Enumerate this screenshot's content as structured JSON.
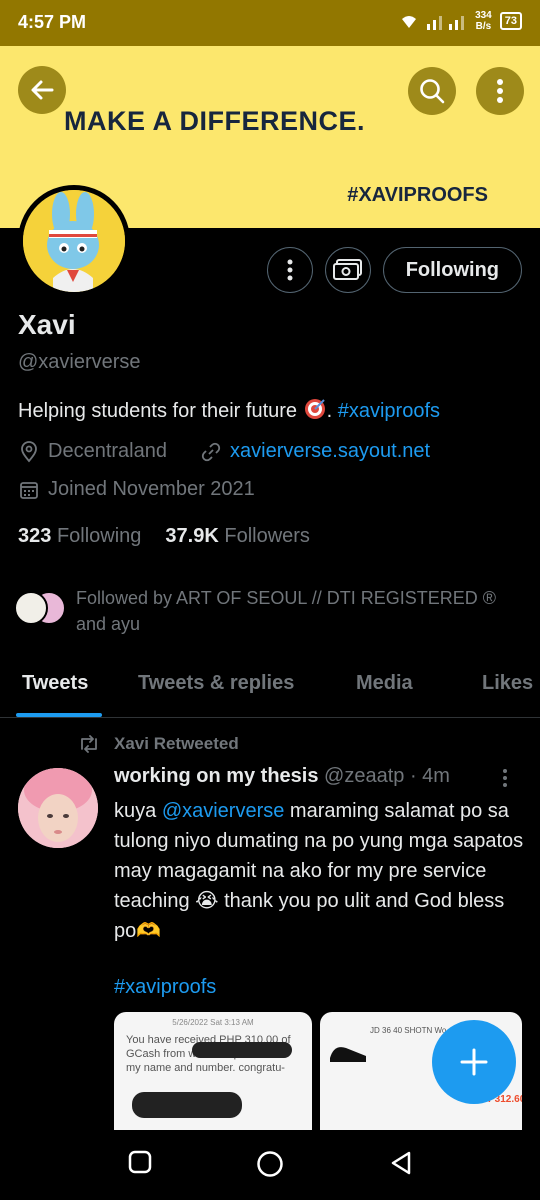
{
  "status_bar": {
    "time": "4:57 PM",
    "speed_value": "334",
    "speed_unit": "B/s",
    "battery": "73"
  },
  "banner": {
    "headline": "MAKE A DIFFERENCE.",
    "hashtag": "#XAVIPROOFS",
    "color": "#fce76d"
  },
  "profile": {
    "following_button": "Following",
    "name": "Xavi",
    "handle": "@xavierverse",
    "bio_text": "Helping students for their future ",
    "bio_suffix": ". ",
    "bio_hashtag": "#xaviproofs",
    "location": "Decentraland",
    "website": "xavierverse.sayout.net",
    "joined": "Joined November 2021",
    "following_count": "323",
    "following_label": "Following",
    "followers_count": "37.9K",
    "followers_label": "Followers",
    "followed_by": "Followed by ART OF SEOUL // DTI REGISTERED ® and ayu"
  },
  "tabs": [
    {
      "label": "Tweets",
      "active": true
    },
    {
      "label": "Tweets & replies",
      "active": false
    },
    {
      "label": "Media",
      "active": false
    },
    {
      "label": "Likes",
      "active": false
    }
  ],
  "tweet": {
    "retweeted_by": "Xavi Retweeted",
    "author_name": "working on my thesis",
    "author_handle": "@zeaatp",
    "time": "· 4m",
    "body_start": "kuya ",
    "mention": "@xavierverse",
    "body_rest": " maraming salamat po sa tulong niyo dumating na po yung mga sapatos may magagamit na ako for my pre service teaching 😭 thank you po ulit and God bless po🫶",
    "hashtag": "#xaviproofs",
    "media_1_text": "You have received PHP 310.00 of GCash from  w/ MSG: please hide my name and number. congratu-",
    "media_1_date": "5/26/2022 Sat 3:13 AM",
    "media_1_amount": "310.00",
    "media_2_title": "JD 36 40 SHOTN Wo",
    "media_2_price": "₱312.60"
  },
  "colors": {
    "accent": "#1d9bf0",
    "status_bar": "#927700",
    "muted": "#71767b"
  }
}
